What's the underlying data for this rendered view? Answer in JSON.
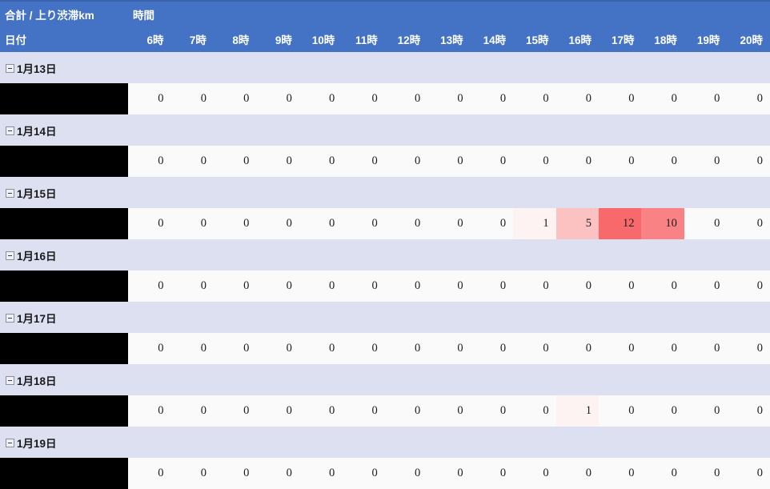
{
  "table": {
    "corner_title": "合計 / 上り渋滞km",
    "time_axis_label": "時間",
    "row_axis_label": "日付",
    "hours": [
      "6時",
      "7時",
      "8時",
      "9時",
      "10時",
      "11時",
      "12時",
      "13時",
      "14時",
      "15時",
      "16時",
      "17時",
      "18時",
      "19時",
      "20時"
    ],
    "expander_icon": "collapse-minus-icon",
    "colors": {
      "header_bg": "#4472c4",
      "header_border": "#3b63ad",
      "group_row_bg": "#dce0f0",
      "data_row_bg": "#fafafa",
      "redaction_bg": "#000000",
      "heat_max": "#f8696b",
      "heat_min": "#fff3f3",
      "text": "#1c1c1c"
    },
    "groups": [
      {
        "label": "1月13日",
        "row_label": "",
        "values": [
          "0",
          "0",
          "0",
          "0",
          "0",
          "0",
          "0",
          "0",
          "0",
          "0",
          "0",
          "0",
          "0",
          "0",
          "0"
        ],
        "heat": [
          0,
          0,
          0,
          0,
          0,
          0,
          0,
          0,
          0,
          0,
          0,
          0,
          0,
          0,
          0
        ]
      },
      {
        "label": "1月14日",
        "row_label": "",
        "values": [
          "0",
          "0",
          "0",
          "0",
          "0",
          "0",
          "0",
          "0",
          "0",
          "0",
          "0",
          "0",
          "0",
          "0",
          "0"
        ],
        "heat": [
          0,
          0,
          0,
          0,
          0,
          0,
          0,
          0,
          0,
          0,
          0,
          0,
          0,
          0,
          0
        ]
      },
      {
        "label": "1月15日",
        "row_label": "",
        "values": [
          "0",
          "0",
          "0",
          "0",
          "0",
          "0",
          "0",
          "0",
          "0",
          "1",
          "5",
          "12",
          "10",
          "0",
          "0"
        ],
        "heat": [
          0,
          0,
          0,
          0,
          0,
          0,
          0,
          0,
          0,
          1,
          5,
          12,
          10,
          0,
          0
        ]
      },
      {
        "label": "1月16日",
        "row_label": "",
        "values": [
          "0",
          "0",
          "0",
          "0",
          "0",
          "0",
          "0",
          "0",
          "0",
          "0",
          "0",
          "0",
          "0",
          "0",
          "0"
        ],
        "heat": [
          0,
          0,
          0,
          0,
          0,
          0,
          0,
          0,
          0,
          0,
          0,
          0,
          0,
          0,
          0
        ]
      },
      {
        "label": "1月17日",
        "row_label": "",
        "values": [
          "0",
          "0",
          "0",
          "0",
          "0",
          "0",
          "0",
          "0",
          "0",
          "0",
          "0",
          "0",
          "0",
          "0",
          "0"
        ],
        "heat": [
          0,
          0,
          0,
          0,
          0,
          0,
          0,
          0,
          0,
          0,
          0,
          0,
          0,
          0,
          0
        ]
      },
      {
        "label": "1月18日",
        "row_label": "",
        "values": [
          "0",
          "0",
          "0",
          "0",
          "0",
          "0",
          "0",
          "0",
          "0",
          "0",
          "1",
          "0",
          "0",
          "0",
          "0"
        ],
        "heat": [
          0,
          0,
          0,
          0,
          0,
          0,
          0,
          0,
          0,
          0,
          1,
          0,
          0,
          0,
          0
        ]
      },
      {
        "label": "1月19日",
        "row_label": "",
        "values": [
          "0",
          "0",
          "0",
          "0",
          "0",
          "0",
          "0",
          "0",
          "0",
          "0",
          "0",
          "0",
          "0",
          "0",
          "0"
        ],
        "heat": [
          0,
          0,
          0,
          0,
          0,
          0,
          0,
          0,
          0,
          0,
          0,
          0,
          0,
          0,
          0
        ]
      }
    ]
  },
  "chart_data": {
    "type": "heatmap",
    "title": "合計 / 上り渋滞km",
    "xlabel": "時間",
    "ylabel": "日付",
    "categories": [
      "6時",
      "7時",
      "8時",
      "9時",
      "10時",
      "11時",
      "12時",
      "13時",
      "14時",
      "15時",
      "16時",
      "17時",
      "18時",
      "19時",
      "20時"
    ],
    "rows": [
      "1月13日",
      "1月14日",
      "1月15日",
      "1月16日",
      "1月17日",
      "1月18日",
      "1月19日"
    ],
    "values": [
      [
        0,
        0,
        0,
        0,
        0,
        0,
        0,
        0,
        0,
        0,
        0,
        0,
        0,
        0,
        0
      ],
      [
        0,
        0,
        0,
        0,
        0,
        0,
        0,
        0,
        0,
        0,
        0,
        0,
        0,
        0,
        0
      ],
      [
        0,
        0,
        0,
        0,
        0,
        0,
        0,
        0,
        0,
        1,
        5,
        12,
        10,
        0,
        0
      ],
      [
        0,
        0,
        0,
        0,
        0,
        0,
        0,
        0,
        0,
        0,
        0,
        0,
        0,
        0,
        0
      ],
      [
        0,
        0,
        0,
        0,
        0,
        0,
        0,
        0,
        0,
        0,
        0,
        0,
        0,
        0,
        0
      ],
      [
        0,
        0,
        0,
        0,
        0,
        0,
        0,
        0,
        0,
        0,
        1,
        0,
        0,
        0,
        0
      ],
      [
        0,
        0,
        0,
        0,
        0,
        0,
        0,
        0,
        0,
        0,
        0,
        0,
        0,
        0,
        0
      ]
    ],
    "colorscale": {
      "min": 0,
      "max": 12,
      "min_color": "#ffffff",
      "max_color": "#f8696b"
    },
    "grid": false,
    "legend": "none"
  }
}
